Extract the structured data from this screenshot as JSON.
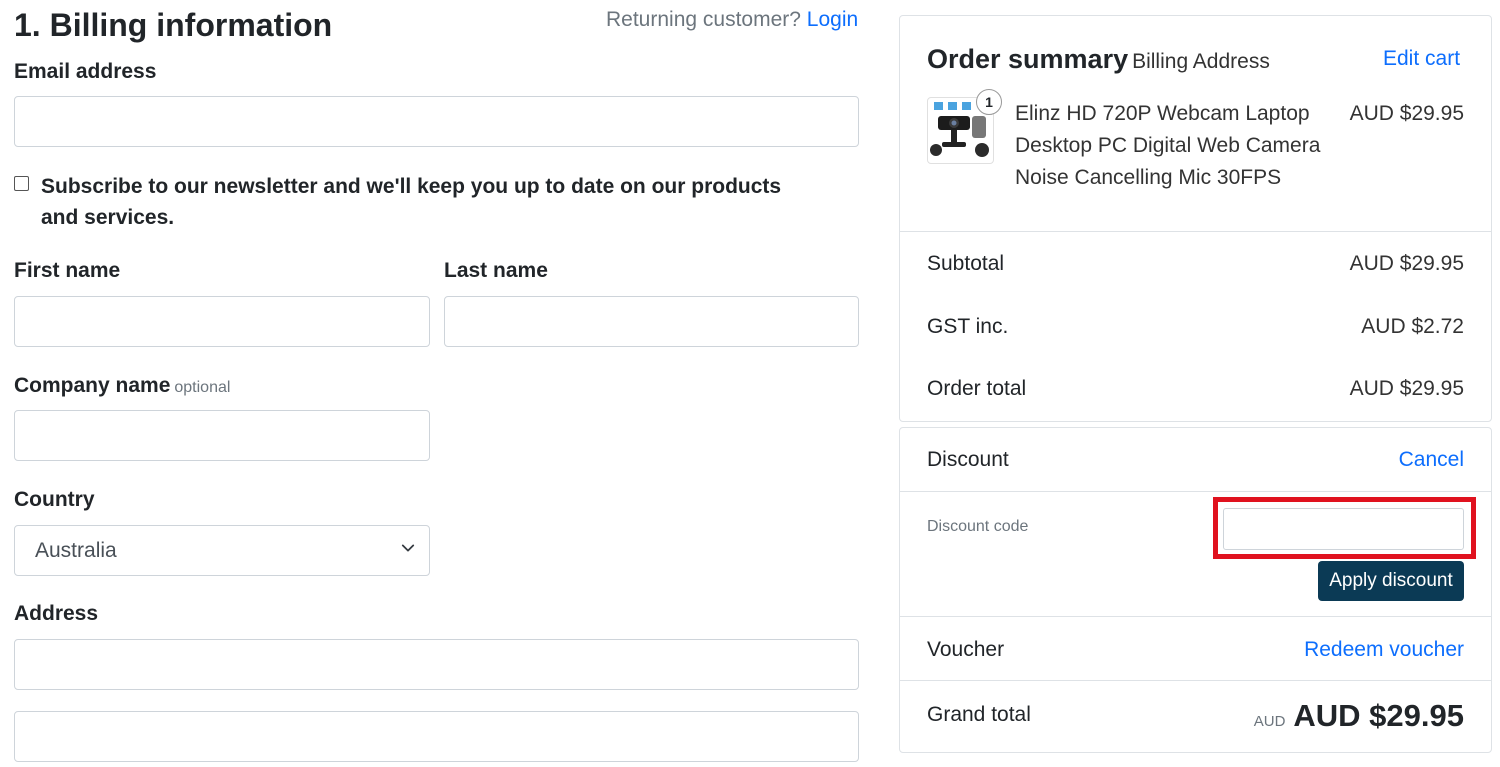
{
  "billing": {
    "heading": "1. Billing information",
    "returning_text": "Returning customer?",
    "login_link": "Login",
    "email_label": "Email address",
    "email_value": "",
    "newsletter_label": "Subscribe to our newsletter and we'll keep you up to date on our products and services.",
    "newsletter_checked": false,
    "first_name_label": "First name",
    "last_name_label": "Last name",
    "company_label": "Company name",
    "company_optional": "optional",
    "country_label": "Country",
    "country_value": "Australia",
    "address_label": "Address"
  },
  "summary": {
    "title": "Order summary",
    "subtitle": "Billing Address",
    "edit_cart": "Edit cart",
    "item": {
      "name": "Elinz HD 720P Webcam Laptop Desktop PC Digital Web Camera Noise Cancelling Mic 30FPS",
      "price": "AUD $29.95",
      "quantity": "1"
    },
    "subtotal_label": "Subtotal",
    "subtotal_value": "AUD $29.95",
    "gst_label": "GST inc.",
    "gst_value": "AUD $2.72",
    "order_total_label": "Order total",
    "order_total_value": "AUD $29.95"
  },
  "discount": {
    "label": "Discount",
    "cancel": "Cancel",
    "code_label": "Discount code",
    "code_value": "",
    "apply_button": "Apply discount"
  },
  "voucher": {
    "label": "Voucher",
    "redeem": "Redeem voucher"
  },
  "grand_total": {
    "label": "Grand total",
    "currency": "AUD",
    "value": "AUD $29.95"
  },
  "colors": {
    "link": "#0d6efd",
    "apply_button_bg": "#0b3a55",
    "highlight": "#e0121f"
  }
}
